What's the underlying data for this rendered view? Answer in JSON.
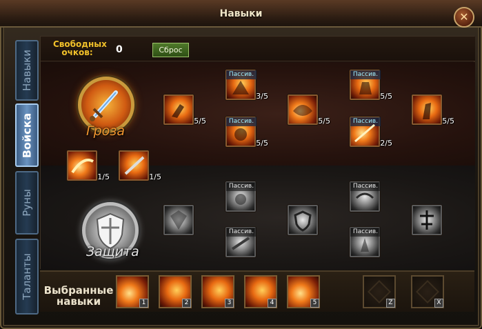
{
  "window": {
    "title": "Навыки"
  },
  "tabs": [
    {
      "label": "Навыки",
      "active": false
    },
    {
      "label": "Войска",
      "active": true
    },
    {
      "label": "Руны",
      "active": false
    },
    {
      "label": "Таланты",
      "active": false
    }
  ],
  "points": {
    "label": "Свободных очков:",
    "value": "0",
    "reset_label": "Сброс"
  },
  "trees": {
    "fire": {
      "name": "Гроза",
      "skills": [
        {
          "level": "5/5",
          "passive": ""
        },
        {
          "level": "3/5",
          "passive": "Пассив."
        },
        {
          "level": "5/5",
          "passive": "Пассив."
        },
        {
          "level": "5/5",
          "passive": ""
        },
        {
          "level": "5/5",
          "passive": "Пассив."
        },
        {
          "level": "2/5",
          "passive": "Пассив."
        },
        {
          "level": "5/5",
          "passive": ""
        },
        {
          "level": "1/5",
          "passive": ""
        },
        {
          "level": "1/5",
          "passive": ""
        }
      ]
    },
    "defense": {
      "name": "Защита",
      "skills": [
        {
          "passive": ""
        },
        {
          "passive": "Пассив."
        },
        {
          "passive": "Пассив."
        },
        {
          "passive": ""
        },
        {
          "passive": "Пассив."
        },
        {
          "passive": "Пассив."
        },
        {
          "passive": ""
        }
      ]
    }
  },
  "selected": {
    "label": "Выбранные навыки",
    "slots": [
      {
        "hotkey": "1"
      },
      {
        "hotkey": "2"
      },
      {
        "hotkey": "3"
      },
      {
        "hotkey": "4"
      },
      {
        "hotkey": "5"
      },
      {
        "hotkey": "Z"
      },
      {
        "hotkey": "X"
      }
    ]
  },
  "colors": {
    "accent_gold": "#f1c12a",
    "fire_name": "#f09530",
    "tab_active": "#6a93c0",
    "reset_button": "#4f7a2a"
  },
  "icons": {
    "close": "close-icon",
    "fire_emblem": "sword-emblem-icon",
    "defense_emblem": "shield-emblem-icon"
  }
}
